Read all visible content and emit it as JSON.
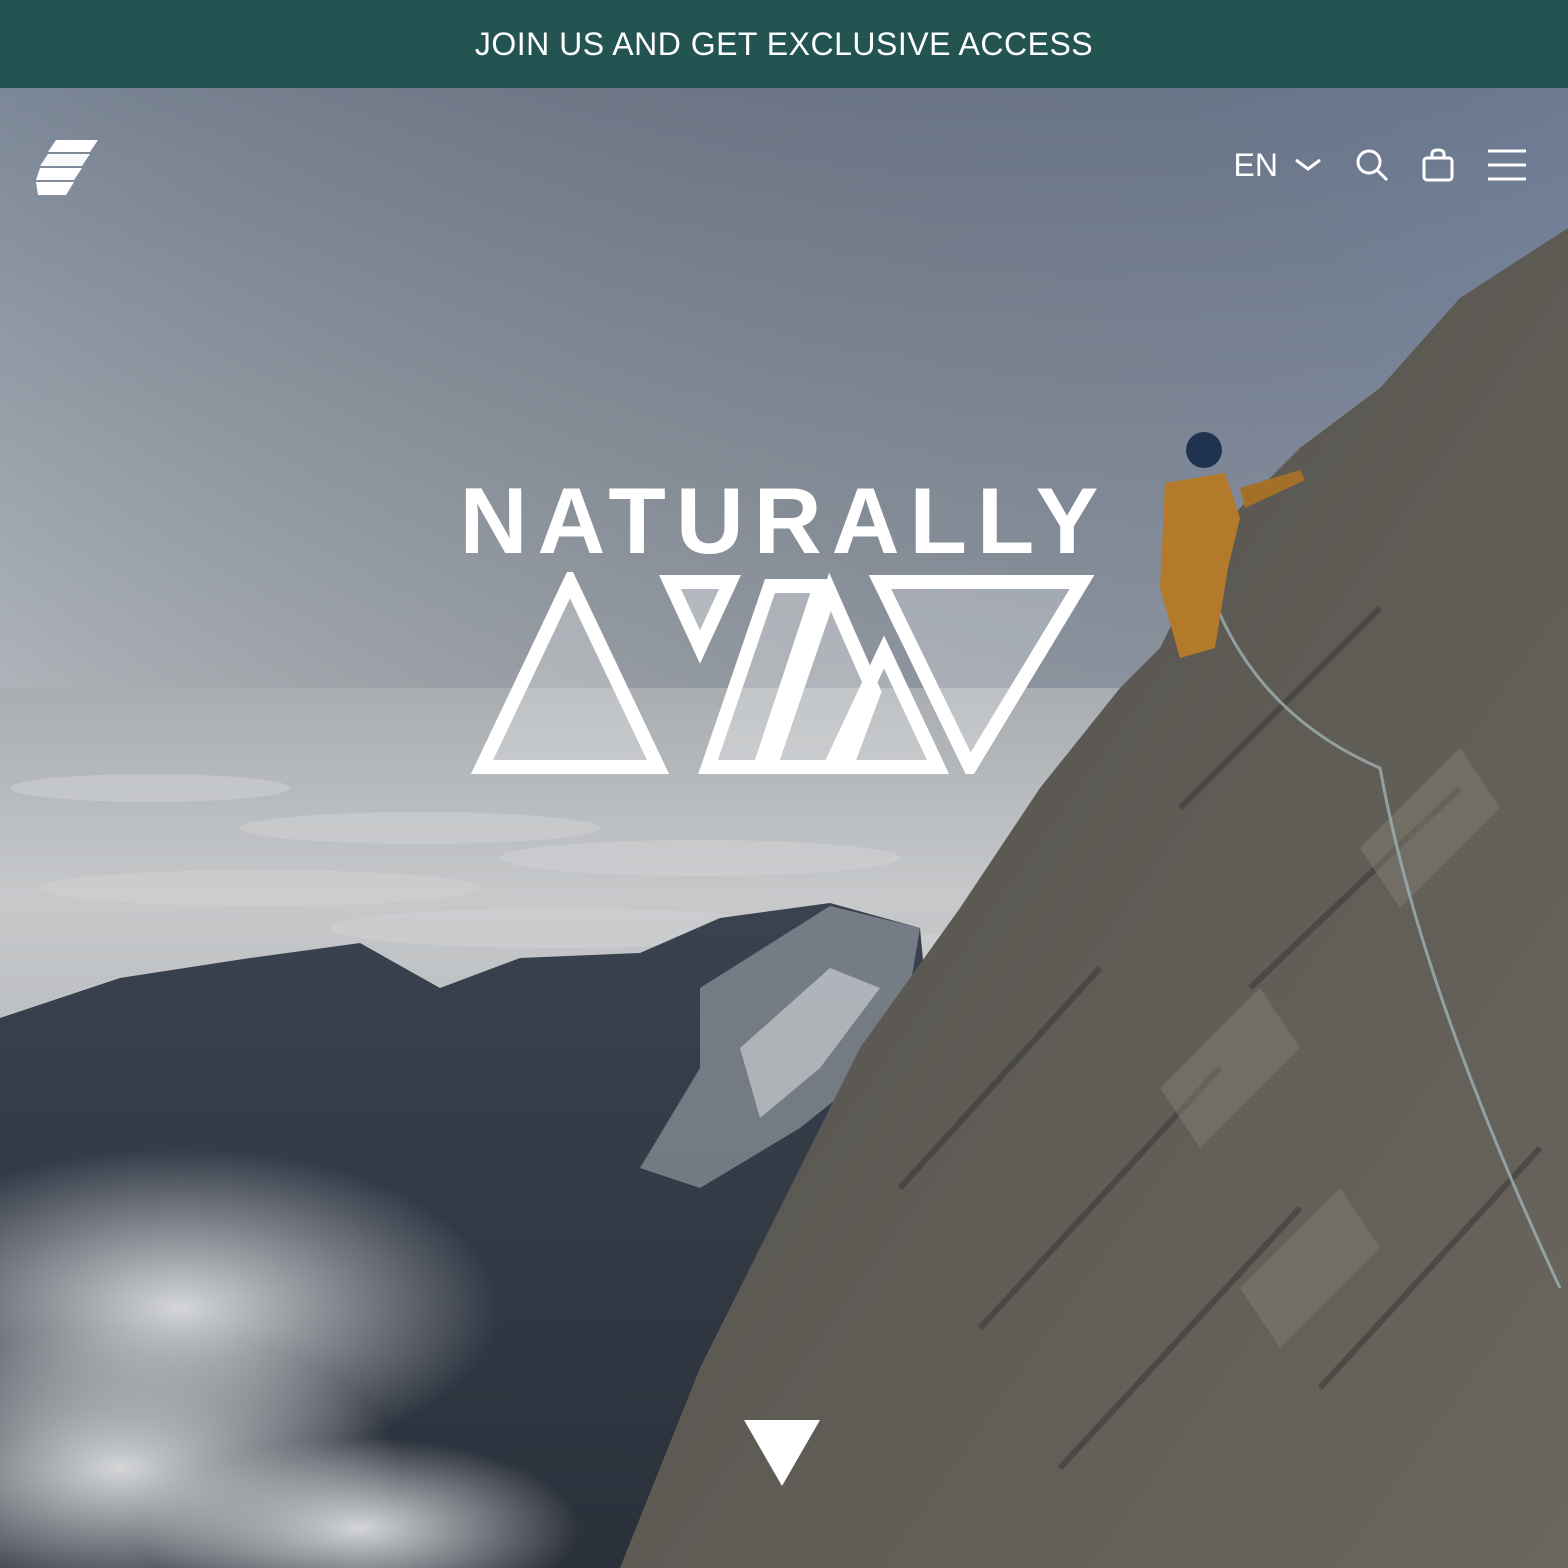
{
  "announcement": {
    "text": "JOIN US AND GET EXCLUSIVE ACCESS"
  },
  "header": {
    "logo_icon": "brand-logo-icon",
    "language": {
      "selected": "EN",
      "icon": "chevron-down-icon"
    },
    "icons": [
      "search-icon",
      "shopping-bag-icon",
      "hamburger-menu-icon"
    ]
  },
  "hero": {
    "title": "NATURALLY",
    "mark_icon": "mountain-triangles-mark",
    "scroll_icon": "down-triangle-icon",
    "background_description_icon": "mountain-climber-photo"
  },
  "colors": {
    "banner": "#235451",
    "text": "#ffffff",
    "sky_top": "#7f8c9b",
    "sky_bottom": "#b7bbbf"
  }
}
